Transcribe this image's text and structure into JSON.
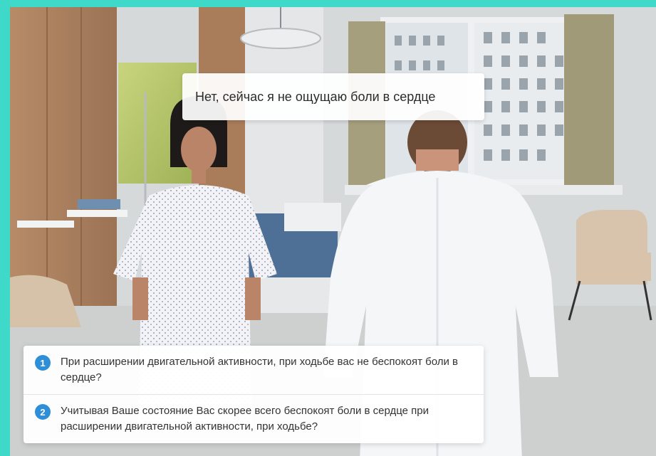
{
  "dialogue": {
    "patient_line": "Нет, сейчас я не ощущаю боли в сердце"
  },
  "options": [
    {
      "number": "1",
      "text": "При расширении двигательной активности, при ходьбе вас не беспокоят боли в сердце?"
    },
    {
      "number": "2",
      "text": "Учитывая Ваше состояние Вас скорее всего беспокоят боли в сердце при расширении двигательной активности, при ходьбе?"
    }
  ],
  "colors": {
    "frame": "#3fd9c9",
    "option_badge": "#2e8fd8"
  }
}
